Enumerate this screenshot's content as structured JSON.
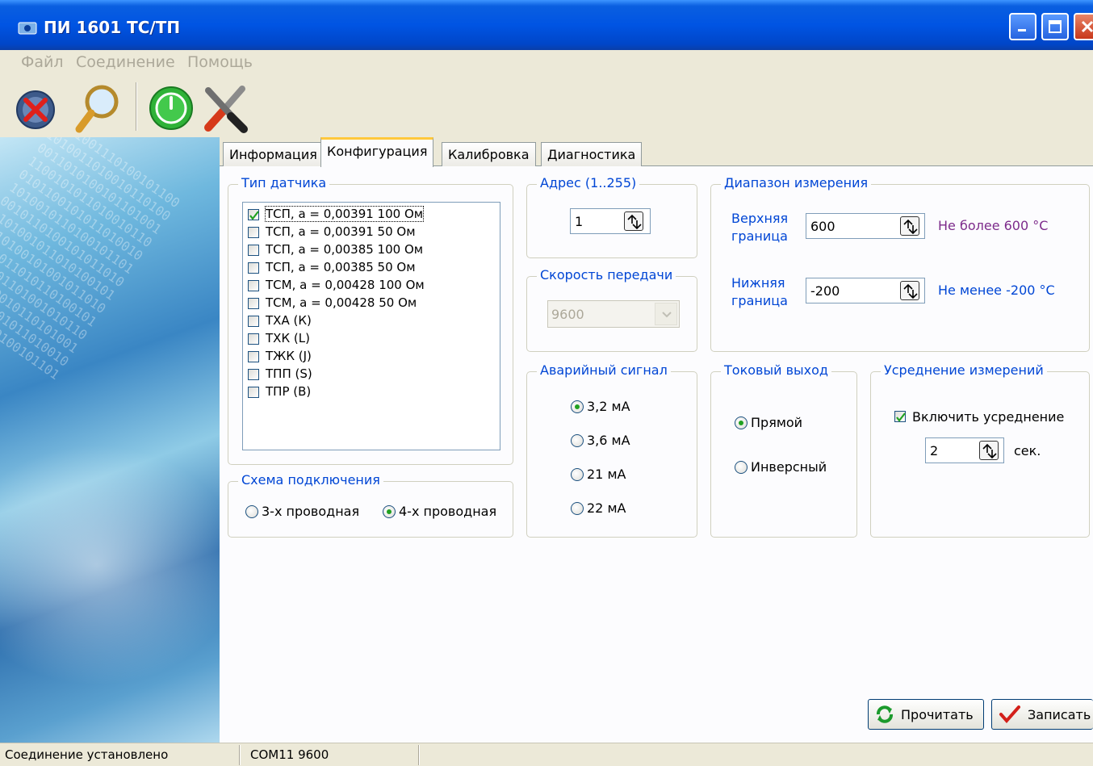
{
  "window": {
    "title": "ПИ 1601 ТС/ТП"
  },
  "menu": {
    "items": [
      "Файл",
      "Соединение",
      "Помощь"
    ]
  },
  "toolbar": {
    "icons": [
      "disconnect-icon",
      "search-icon",
      "power-icon",
      "settings-tools-icon"
    ]
  },
  "side": {
    "digits": "0101001110100101100\n1010011010010110100\n0011010100101101001\n1100101011010010110\n0101100101011010010\n1010010110100101101\n0010110100101011010\n1101001011010100101\n0110100101001011010\n1001011010110100101\n0100101101001010110\n1011010010110101001\n0101101001011010010\n1010010110100101101"
  },
  "tabs": {
    "labels": [
      "Информация",
      "Конфигурация",
      "Калибровка",
      "Диагностика"
    ],
    "active": "Конфигурация"
  },
  "sensor": {
    "title": "Тип датчика",
    "items": [
      {
        "label": "ТСП, a = 0,00391 100 Ом",
        "checked": true
      },
      {
        "label": "ТСП, a = 0,00391 50 Ом",
        "checked": false
      },
      {
        "label": "ТСП, a = 0,00385 100 Ом",
        "checked": false
      },
      {
        "label": "ТСП, a = 0,00385 50 Ом",
        "checked": false
      },
      {
        "label": "ТСМ, a = 0,00428 100 Ом",
        "checked": false
      },
      {
        "label": "ТСМ, a = 0,00428 50 Ом",
        "checked": false
      },
      {
        "label": "ТХА (К)",
        "checked": false
      },
      {
        "label": "ТХК (L)",
        "checked": false
      },
      {
        "label": "ТЖК (J)",
        "checked": false
      },
      {
        "label": "ТПП (S)",
        "checked": false
      },
      {
        "label": "ТПР (В)",
        "checked": false
      }
    ]
  },
  "wiring": {
    "title": "Схема подключения",
    "options": [
      "3-х проводная",
      "4-х проводная"
    ],
    "selected": "4-х проводная"
  },
  "address": {
    "title": "Адрес (1..255)",
    "value": "1"
  },
  "baud": {
    "title": "Скорость передачи",
    "value": "9600"
  },
  "range": {
    "title": "Диапазон измерения",
    "upper_label_1": "Верхняя",
    "upper_label_2": "граница",
    "upper_value": "600",
    "upper_hint": "Не более 600 °С",
    "lower_label_1": "Нижняя",
    "lower_label_2": "граница",
    "lower_value": "-200",
    "lower_hint": "Не менее -200 °С"
  },
  "alarm": {
    "title": "Аварийный сигнал",
    "options": [
      "3,2 мА",
      "3,6 мА",
      "21 мА",
      "22 мА"
    ],
    "selected": "3,2 мА"
  },
  "current_out": {
    "title": "Токовый выход",
    "options": [
      "Прямой",
      "Инверсный"
    ],
    "selected": "Прямой"
  },
  "averaging": {
    "title": "Усреднение измерений",
    "enable_label": "Включить усреднение",
    "enabled": true,
    "value": "2",
    "unit": "сек."
  },
  "actions": {
    "read": "Прочитать",
    "write": "Записать"
  },
  "status": {
    "connection": "Соединение установлено",
    "port": "COM11 9600"
  },
  "colors": {
    "titlebar": "#0054e3",
    "group_title": "#0046d5",
    "hint": "#7d2b8b",
    "radio_dot": "#21a121",
    "active_tab": "#ffc83c"
  }
}
